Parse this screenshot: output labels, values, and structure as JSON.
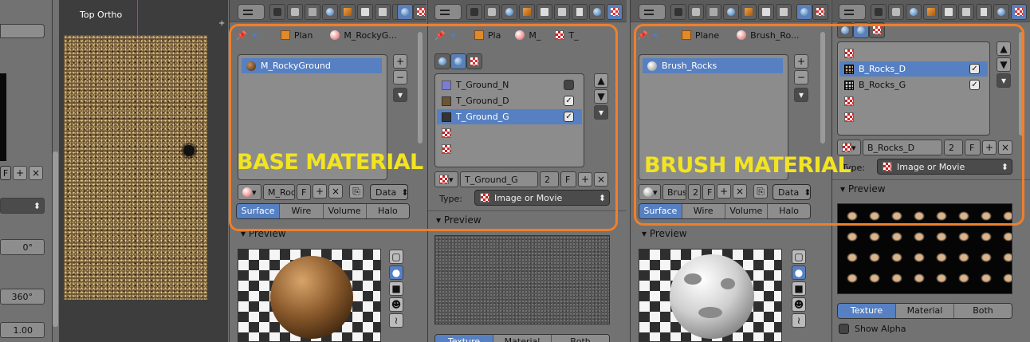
{
  "left_panel": {
    "rot1": "0°",
    "rot2": "360°",
    "scale": "1.00"
  },
  "viewport": {
    "title": "Top Ortho"
  },
  "panel1": {
    "breadcrumb": [
      "Plan",
      "M_RockyG..."
    ],
    "material_item": "M_RockyGround",
    "slot_name": "M_Roc",
    "slot_users": "F",
    "link": "Data",
    "tabs": [
      "Surface",
      "Wire",
      "Volume",
      "Halo"
    ],
    "preview": "Preview"
  },
  "panel2": {
    "breadcrumb": [
      "Pla",
      "M_",
      "T_"
    ],
    "textures": [
      "T_Ground_N",
      "T_Ground_D",
      "T_Ground_G"
    ],
    "tex_name": "T_Ground_G",
    "tex_users": "2",
    "tex_fake": "F",
    "type_label": "Type:",
    "type_value": "Image or Movie",
    "preview": "Preview",
    "bottom_tabs": [
      "Texture",
      "Material",
      "Both"
    ]
  },
  "panel3": {
    "breadcrumb": [
      "Plane",
      "Brush_Ro..."
    ],
    "material_item": "Brush_Rocks",
    "slot_name": "Brus",
    "slot_users": "2",
    "slot_fake": "F",
    "link": "Data",
    "tabs": [
      "Surface",
      "Wire",
      "Volume",
      "Halo"
    ],
    "preview": "Preview"
  },
  "panel4": {
    "textures": [
      "B_Rocks_D",
      "B_Rocks_G"
    ],
    "tex_name": "B_Rocks_D",
    "tex_users": "2",
    "tex_fake": "F",
    "type_label": "Type:",
    "type_value": "Image or Movie",
    "preview": "Preview",
    "bottom_tabs": [
      "Texture",
      "Material",
      "Both"
    ],
    "show_alpha": "Show Alpha"
  },
  "overlays": {
    "base": "BASE MATERIAL",
    "brush": "BRUSH MATERIAL"
  },
  "colors": {
    "annotation_border": "#f07f2a",
    "annotation_text": "#f2e421",
    "selection": "#5680c2"
  }
}
